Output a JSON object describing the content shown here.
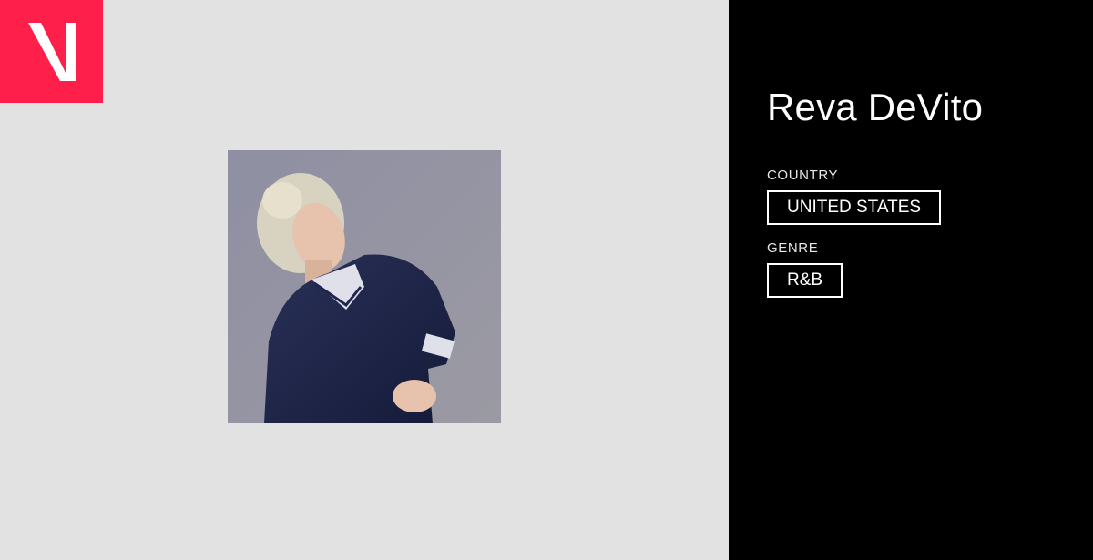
{
  "brand": {
    "logo_icon": "v-logo-icon",
    "color": "#ff1f4b"
  },
  "artist": {
    "name": "Reva DeVito",
    "photo_icon": "artist-photo"
  },
  "details": {
    "country_label": "COUNTRY",
    "country_value": "UNITED STATES",
    "genre_label": "GENRE",
    "genre_value": "R&B"
  },
  "colors": {
    "left_bg": "#e2e2e2",
    "right_bg": "#000000",
    "text": "#ffffff"
  }
}
